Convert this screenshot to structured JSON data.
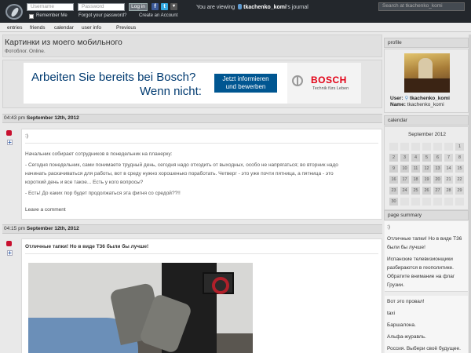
{
  "topbar": {
    "username_placeholder": "Username",
    "password_placeholder": "Password",
    "login_label": "Log in",
    "remember_me": "Remember Me",
    "forgot_password": "Forgot your password?",
    "create_account": "Create an Account",
    "viewing_prefix": "You are viewing",
    "viewing_user": "tkachenko_komi",
    "viewing_suffix": "'s journal",
    "search_placeholder": "Search at tkachenko_komi"
  },
  "nav": [
    "entries",
    "friends",
    "calendar",
    "user info",
    "Previous"
  ],
  "header": {
    "title": "Картинки из моего мобильного",
    "subtitle": "Фотоблог. Online."
  },
  "ad": {
    "line1": "Arbeiten Sie bereits bei Bosch?",
    "line2": "Wenn nicht:",
    "button_line1": "Jetzt informieren",
    "button_line2": "und bewerben",
    "brand": "BOSCH",
    "tagline": "Technik fürs Leben"
  },
  "entries": [
    {
      "time": "04:43 pm",
      "date": "September 12th, 2012",
      "subject": ":)",
      "lines": [
        "Начальник собирает сотрудников в понедельник на планерку:",
        "- Сегодня понедельник, сами понимаете трудный день, сегодня надо отходить от выходных, особо не напрягаться; во вторник надо",
        "начинать раскачиваться для работы, вот в среду нужно хорошенько поработать. Четверг - это уже почти пятница, а пятница - это",
        "короткий день и все такое... Есть у кого вопросы?",
        "- Есть! До каких пор будет продолжаться эта фигня со средой??!!"
      ],
      "comment_link": "Leave a comment"
    },
    {
      "time": "04:15 pm",
      "date": "September 12th, 2012",
      "subject": "Отличные тапки! Но в виде Т36 были бы лучше!"
    }
  ],
  "sidebar": {
    "profile_heading": "profile",
    "user_label": "User:",
    "user_value": "tkachenko_komi",
    "name_label": "Name:",
    "name_value": "tkachenko_komi",
    "calendar_heading": "calendar",
    "calendar_month": "September 2012",
    "calendar_days": [
      "1",
      "2",
      "3",
      "4",
      "5",
      "6",
      "7",
      "8",
      "9",
      "10",
      "11",
      "12",
      "13",
      "14",
      "15",
      "16",
      "17",
      "18",
      "19",
      "20",
      "21",
      "22",
      "23",
      "24",
      "25",
      "26",
      "27",
      "28",
      "29",
      "30"
    ],
    "summary_heading": "page summary",
    "summary_items": [
      ":)",
      "Отличные тапки! Но в виде Т36 были бы лучше!",
      "Испанские телевизионщики разбираются в геополитике. Обратите внимание на флаг Грузии.",
      "Вот это провал!",
      "taxi",
      "Баршалона.",
      "Альфа-журавль.",
      "Россия. Выбери своё будущее."
    ]
  },
  "colors": {
    "topbar": "#23272c",
    "bosch_red": "#e20015",
    "bosch_blue": "#005691"
  }
}
